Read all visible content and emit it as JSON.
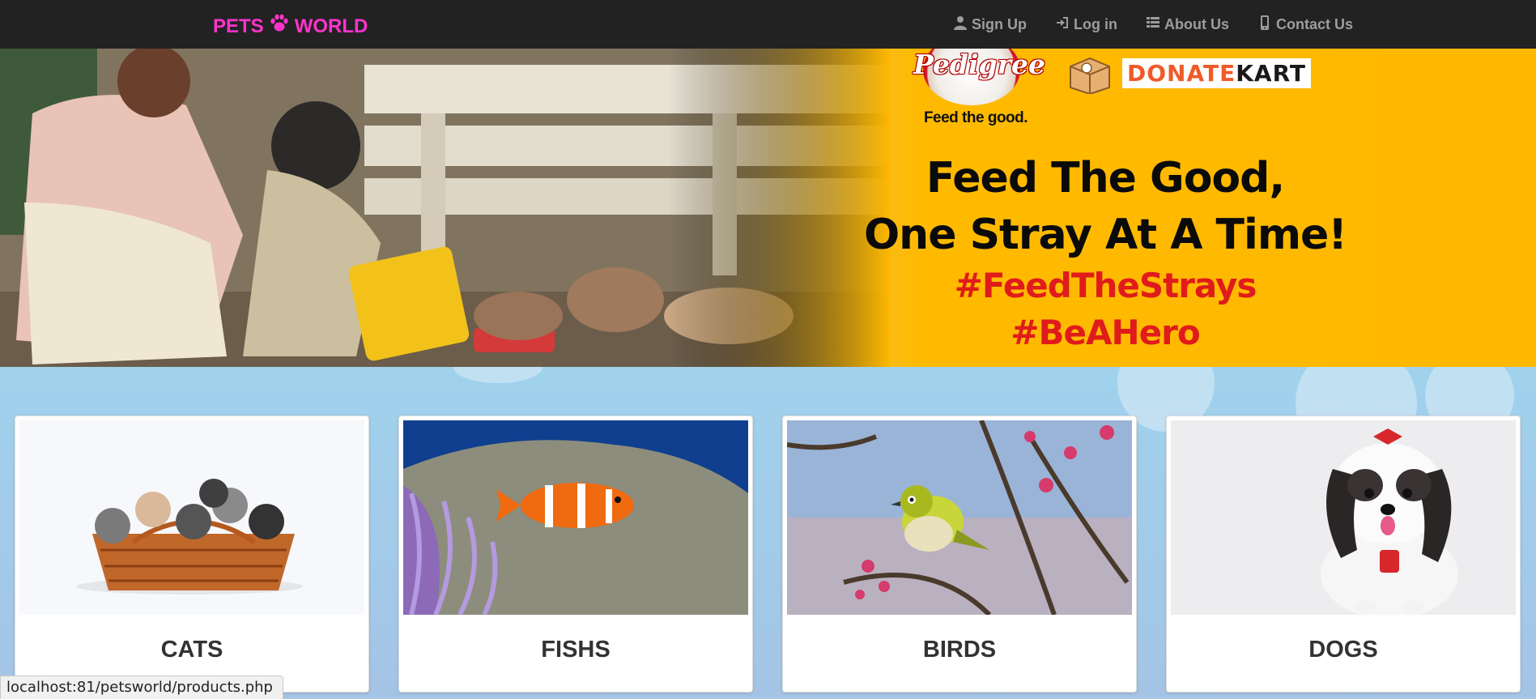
{
  "navbar": {
    "brand_left": "PETS",
    "brand_right": "WORLD",
    "brand_icon": "paw-icon",
    "brand_color": "#ff33cc",
    "items": [
      {
        "label": "Sign Up",
        "icon": "user-icon"
      },
      {
        "label": "Log in",
        "icon": "log-in-icon"
      },
      {
        "label": "About Us",
        "icon": "list-icon"
      },
      {
        "label": "Contact Us",
        "icon": "phone-icon"
      }
    ]
  },
  "banner": {
    "pedigree_brand": "Pedigree",
    "pedigree_tagline": "Feed the good.",
    "partner_brand_part1": "DONATE",
    "partner_brand_part2": "KART",
    "headline_line1": "Feed The Good,",
    "headline_line2": "One Stray At A Time!",
    "hashtag1": "#FeedTheStrays",
    "hashtag2": "#BeAHero"
  },
  "categories": [
    {
      "title": "CATS"
    },
    {
      "title": "FISHS"
    },
    {
      "title": "BIRDS"
    },
    {
      "title": "DOGS"
    }
  ],
  "status_bar": {
    "url": "localhost:81/petsworld/products.php"
  }
}
